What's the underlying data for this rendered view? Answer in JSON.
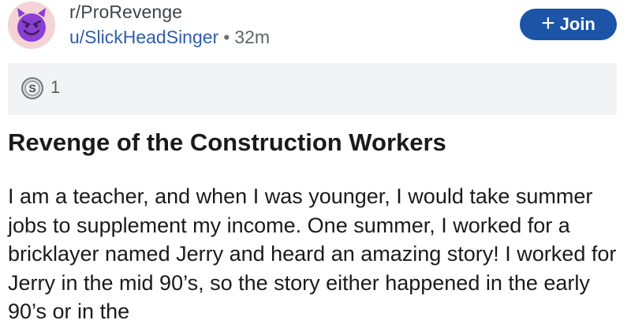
{
  "post": {
    "subreddit": "r/ProRevenge",
    "author": "u/SlickHeadSinger",
    "separator": "•",
    "time": "32m",
    "join_label": "Join",
    "join_icon": "plus-icon",
    "award_icon": "silver-award-icon",
    "award_count": "1",
    "title": "Revenge of the Construction Workers",
    "body": "I am a teacher, and when I was younger, I would take summer jobs to supplement my income.  One summer, I worked for a bricklayer named Jerry and heard an amazing story!  I worked for Jerry in the mid 90’s, so the story either happened in the early 90’s or in the"
  },
  "colors": {
    "join_bg": "#1c54a8",
    "author": "#2f5da8",
    "avatar_bg": "#f3d3d6",
    "avatar_face": "#8a3fd1",
    "award_bar_bg": "#f2f3f4"
  }
}
